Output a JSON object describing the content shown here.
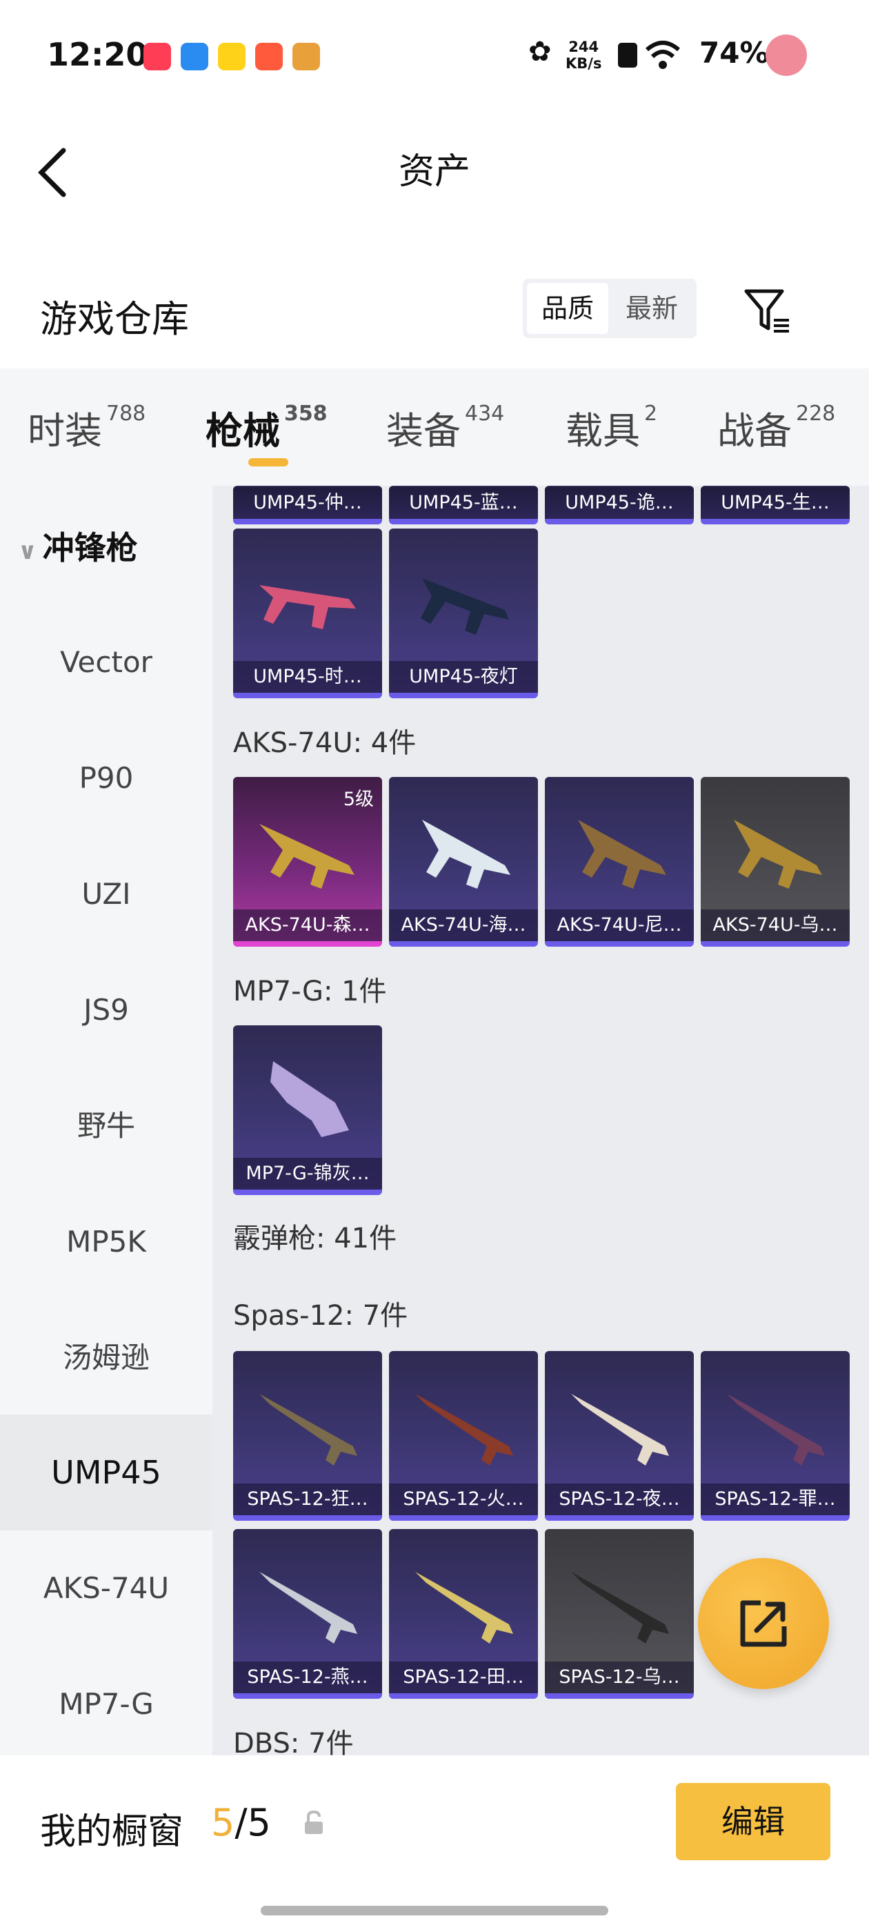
{
  "status_bar": {
    "time": "12:20",
    "net_speed_value": "244",
    "net_speed_unit": "KB/s",
    "battery": "74%",
    "app_icons": [
      "app-icon-1",
      "app-icon-2",
      "app-icon-3",
      "app-icon-4",
      "app-icon-5"
    ]
  },
  "header": {
    "title": "资产"
  },
  "warehouse": {
    "title": "游戏仓库",
    "sort_quality": "品质",
    "sort_latest": "最新"
  },
  "tabs": [
    {
      "label": "时装",
      "count": "788"
    },
    {
      "label": "枪械",
      "count": "358"
    },
    {
      "label": "装备",
      "count": "434"
    },
    {
      "label": "载具",
      "count": "2"
    },
    {
      "label": "战备",
      "count": "228"
    }
  ],
  "sidebar": {
    "category": "冲锋枪",
    "items": [
      "Vector",
      "P90",
      "UZI",
      "JS9",
      "野牛",
      "MP5K",
      "汤姆逊",
      "UMP45",
      "AKS-74U",
      "MP7-G"
    ]
  },
  "main": {
    "ump_top": [
      "UMP45-仲…",
      "UMP45-蓝…",
      "UMP45-诡…",
      "UMP45-生…"
    ],
    "ump_row": [
      "UMP45-时…",
      "UMP45-夜灯"
    ],
    "aks_header": "AKS-74U: 4件",
    "aks_items": [
      "AKS-74U-森…",
      "AKS-74U-海…",
      "AKS-74U-尼…",
      "AKS-74U-乌…"
    ],
    "aks_level": "5级",
    "mp7_header": "MP7-G: 1件",
    "mp7_items": [
      "MP7-G-锦灰…"
    ],
    "shotgun_header": "霰弹枪: 41件",
    "spas_header": "Spas-12: 7件",
    "spas_items": [
      "SPAS-12-狂…",
      "SPAS-12-火…",
      "SPAS-12-夜…",
      "SPAS-12-罪…",
      "SPAS-12-燕…",
      "SPAS-12-田…",
      "SPAS-12-乌…"
    ],
    "dbs_header": "DBS: 7件"
  },
  "showcase": {
    "label": "我的橱窗",
    "current": "5",
    "total": "/5",
    "edit_label": "编辑"
  },
  "colors": {
    "accent": "#f6bf3f",
    "rarity_purple": "#6a5ce8",
    "rarity_pink": "#e044d0"
  }
}
